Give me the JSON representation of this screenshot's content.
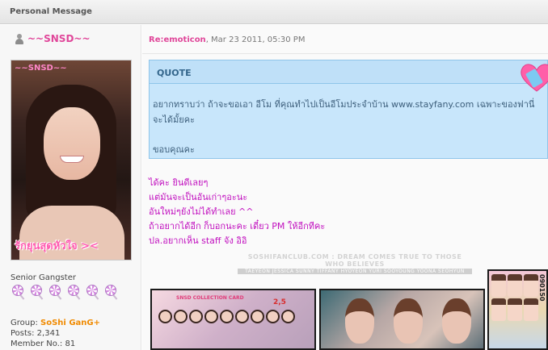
{
  "header": {
    "title": "Personal Message"
  },
  "author": {
    "name": "~~SNSD~~",
    "avatar_tag": "~~SNSD~~",
    "avatar_banner": "รักยุนสุดหัวใจ >< ",
    "rank": "Senior Gangster",
    "rank_icons": 6,
    "group_label": "Group:",
    "group_value": "SoShi GanG+",
    "posts": "Posts: 2,341",
    "member_no": "Member No.: 81"
  },
  "post": {
    "subject": "Re:emoticon",
    "date": "Mar 23 2011, 05:30 PM",
    "quote_label": "QUOTE",
    "quote_text": "อยากทราบว่า ถ้าจะขอเอา อีโม ที่คุณทำไปเป็นอีโมประจำบ้าน www.stayfany.com เฉพาะของฟานี่ จะได้มั้ยคะ",
    "quote_thanks": "ขอบคุณคะ",
    "lines": [
      "ได้คะ ยินดีเลยๆ",
      "แต่มันจะเป็นอันเก่าๆอะนะ",
      "อันใหม่ๆยังไม่ได้ทำเลย ^^",
      "ถ้าอยากได้อีก ก็บอกนะคะ เดี๋ยว PM ให้อีกทีคะ",
      "ปล.อยากเห็น staff จัง อิอิ"
    ]
  },
  "signature": {
    "line1": "SOSHIFANCLUB.COM : DREAM COMES TRUE TO THOSE WHO BELIEVES",
    "line2": "TAEYEON JESSICA SUNNY TIFFANY HYOYEON YURI SOOYOUNG YOONA SEOHYUN",
    "pic1_caption": "SNSD COLLECTION CARD",
    "pic1_number": "2,5",
    "pic3_vertical": "090150"
  },
  "colors": {
    "accent_pink": "#e0479a",
    "message_text": "#c10fbf",
    "quote_bg": "#c8e6fb",
    "group_orange": "#f08a00"
  }
}
